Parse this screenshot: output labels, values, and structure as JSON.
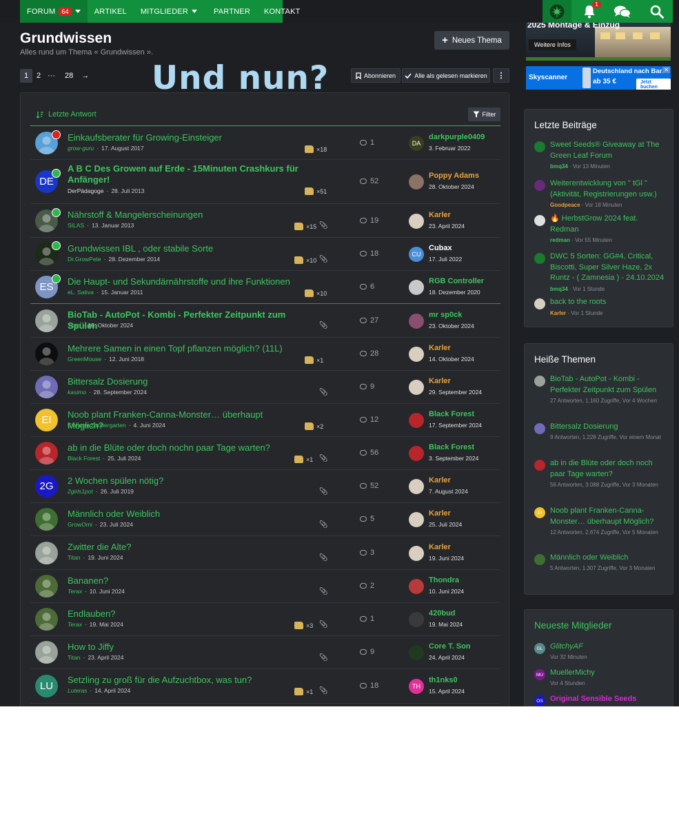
{
  "nav": {
    "items": [
      {
        "label": "FORUM",
        "count": "64",
        "caret": true
      },
      {
        "label": "ARTIKEL"
      },
      {
        "label": "MITGLIEDER",
        "caret": true
      },
      {
        "label": "PARTNER"
      },
      {
        "label": "KONTAKT"
      }
    ],
    "bell_count": "1",
    "icons": [
      "cannabis-leaf-icon",
      "bell-icon",
      "chat-bubbles-icon",
      "search-icon"
    ]
  },
  "page": {
    "title": "Grundwissen",
    "description": "Alles rund um Thema « Grundwissen ».",
    "new_thread": "Neues Thema",
    "overlay_text": "Und nun?"
  },
  "pager": {
    "pages": [
      "1",
      "2",
      "···",
      "28"
    ],
    "current": "1",
    "next": "→"
  },
  "actions": {
    "subscribe": "Abonnieren",
    "mark_read": "Alle als gelesen markieren",
    "more": "⋮"
  },
  "filterbar": {
    "sort": "Letzte Antwort",
    "filter": "Filter"
  },
  "ads": {
    "ad1": {
      "title": "2025 Montage & Einzug",
      "button": "Weitere Infos"
    },
    "ad2": {
      "brand": "Skyscanner",
      "deal": "Deutschland nach Bar...",
      "price": "ab 35 €",
      "cta": "Jetzt buchen",
      "close": "✕"
    }
  },
  "threads": [
    {
      "title": "Einkaufsberater für Growing-Einsteiger",
      "author": "grow-guru",
      "author_italic": true,
      "date": "17. August 2017",
      "likes": "×18",
      "attach": false,
      "replies": "1",
      "last_user": "darkpurple0409",
      "last_date": "3. Februar 2022",
      "last_color": "#3ec55e",
      "last_initials": "DA",
      "last_bg": "#3b3d1f",
      "avatar_initials": "",
      "avatar_bg": "#5aa0d8",
      "badge": "red",
      "bold": false
    },
    {
      "title": "A B C Des Growen auf Erde - 15Minuten Crashkurs für Anfänger!",
      "author": "DerPädagoge",
      "author_italic": false,
      "author_color": "#e0e0e0",
      "date": "28. Juli 2013",
      "likes": "×51",
      "attach": false,
      "replies": "52",
      "last_user": "Poppy Adams",
      "last_date": "28. Oktober 2024",
      "last_color": "#e8a33c",
      "last_initials": "",
      "last_bg": "#8a7264",
      "avatar_initials": "DE",
      "avatar_bg": "#1a36c9",
      "badge": "green",
      "bold": true
    },
    {
      "title": "Nährstoff & Mangelerscheinungen",
      "author": "SILAS",
      "author_italic": false,
      "date": "13. Januar 2013",
      "likes": "×15",
      "attach": true,
      "replies": "19",
      "last_user": "Karler",
      "last_date": "23. April 2024",
      "last_color": "#e8a33c",
      "last_initials": "",
      "last_bg": "#d8cfc0",
      "avatar_initials": "",
      "avatar_bg": "#4a5a48",
      "badge": "green",
      "bold": false
    },
    {
      "title": "Grundwissen IBL , oder stabile Sorte",
      "author": "Dr.GrowPete",
      "author_italic": false,
      "date": "28. Dezember 2014",
      "likes": "×10",
      "attach": true,
      "replies": "18",
      "last_user": "Cubax",
      "last_date": "17. Juli 2022",
      "last_color": "#ffffff",
      "last_initials": "CU",
      "last_bg": "#4a8fd6",
      "avatar_initials": "",
      "avatar_bg": "#1c2a16",
      "badge": "green",
      "bold": false
    },
    {
      "title": "Die Haupt- und Sekundärnährstoffe und ihre Funktionen",
      "author": "eL. Sativa",
      "author_italic": false,
      "date": "15. Januar 2011",
      "likes": "×10",
      "attach": false,
      "replies": "6",
      "last_user": "RGB Controller",
      "last_date": "18. Dezember 2020",
      "last_color": "#3ec55e",
      "last_initials": "",
      "last_bg": "#c9c9c9",
      "avatar_initials": "ES",
      "avatar_bg": "#7d94c4",
      "badge": "green",
      "bold": false
    },
    {
      "title": "BioTab - AutoPot - Kombi - Perfekter Zeitpunkt zum Spülen",
      "author": "Titan",
      "author_italic": false,
      "date": "15. Oktober 2024",
      "likes": "",
      "attach": true,
      "replies": "27",
      "last_user": "mr sp0ck",
      "last_date": "23. Oktober 2024",
      "last_color": "#3ec55e",
      "last_initials": "",
      "last_bg": "#8a4e6e",
      "avatar_initials": "",
      "avatar_bg": "#9aa39a",
      "badge": "",
      "bold": true
    },
    {
      "title": "Mehrere Samen in einen Topf pflanzen möglich? (11L)",
      "author": "GreenMouse",
      "author_italic": false,
      "date": "12. Juni 2018",
      "likes": "×1",
      "attach": false,
      "replies": "28",
      "last_user": "Karler",
      "last_date": "14. Oktober 2024",
      "last_color": "#e8a33c",
      "last_initials": "",
      "last_bg": "#d8cfc0",
      "avatar_initials": "",
      "avatar_bg": "#0d0d0d",
      "badge": "",
      "bold": false
    },
    {
      "title": "Bittersalz Dosierung",
      "author": "kasimo",
      "author_italic": true,
      "date": "28. September 2024",
      "likes": "",
      "attach": true,
      "replies": "9",
      "last_user": "Karler",
      "last_date": "29. September 2024",
      "last_color": "#e8a33c",
      "last_initials": "",
      "last_bg": "#d8cfc0",
      "avatar_initials": "",
      "avatar_bg": "#6f6bb5",
      "badge": "",
      "bold": false
    },
    {
      "title": "Noob plant Franken-Canna-Monster… überhaupt Möglich?",
      "author": "EinhornsZaubergarten",
      "author_italic": false,
      "date": "4. Juni 2024",
      "likes": "×2",
      "attach": false,
      "replies": "12",
      "last_user": "Black Forest",
      "last_date": "17. September 2024",
      "last_color": "#3ec55e",
      "last_initials": "",
      "last_bg": "#b8252a",
      "avatar_initials": "EI",
      "avatar_bg": "#f2c12e",
      "badge": "",
      "bold": false
    },
    {
      "title": "ab in die Blüte oder doch nochn paar Tage warten?",
      "author": "Black Forest",
      "author_italic": false,
      "date": "25. Juli 2024",
      "likes": "×1",
      "attach": true,
      "replies": "56",
      "last_user": "Black Forest",
      "last_date": "3. September 2024",
      "last_color": "#3ec55e",
      "last_initials": "",
      "last_bg": "#b8252a",
      "avatar_initials": "",
      "avatar_bg": "#b8252a",
      "badge": "",
      "bold": false
    },
    {
      "title": "2 Wochen spülen nötig?",
      "author": "2girls1pot",
      "author_italic": true,
      "date": "26. Juli 2019",
      "likes": "",
      "attach": true,
      "replies": "52",
      "last_user": "Karler",
      "last_date": "7. August 2024",
      "last_color": "#e8a33c",
      "last_initials": "",
      "last_bg": "#d8cfc0",
      "avatar_initials": "2G",
      "avatar_bg": "#1a18c4",
      "badge": "",
      "bold": false
    },
    {
      "title": "Männlich oder Weiblich",
      "author": "GrowOmi",
      "author_italic": false,
      "date": "23. Juli 2024",
      "likes": "",
      "attach": true,
      "replies": "5",
      "last_user": "Karler",
      "last_date": "25. Juli 2024",
      "last_color": "#e8a33c",
      "last_initials": "",
      "last_bg": "#d8cfc0",
      "avatar_initials": "",
      "avatar_bg": "#3f6e32",
      "badge": "",
      "bold": false
    },
    {
      "title": "Zwitter die Alte?",
      "author": "Titan",
      "author_italic": false,
      "date": "19. Juni 2024",
      "likes": "",
      "attach": true,
      "replies": "3",
      "last_user": "Karler",
      "last_date": "19. Juni 2024",
      "last_color": "#e8a33c",
      "last_initials": "",
      "last_bg": "#d8cfc0",
      "avatar_initials": "",
      "avatar_bg": "#9aa39a",
      "badge": "",
      "bold": false
    },
    {
      "title": "Bananen?",
      "author": "Terax",
      "author_italic": true,
      "date": "10. Juni 2024",
      "likes": "",
      "attach": true,
      "replies": "2",
      "last_user": "Thondra",
      "last_date": "10. Juni 2024",
      "last_color": "#3ec55e",
      "last_initials": "",
      "last_bg": "#b83a3a",
      "avatar_initials": "",
      "avatar_bg": "#4c6b36",
      "badge": "",
      "bold": false
    },
    {
      "title": "Endlauben?",
      "author": "Terax",
      "author_italic": true,
      "date": "19. Mai 2024",
      "likes": "×3",
      "attach": true,
      "replies": "1",
      "last_user": "420bud",
      "last_date": "19. Mai 2024",
      "last_color": "#3ec55e",
      "last_initials": "",
      "last_bg": "#3a3a3a",
      "avatar_initials": "",
      "avatar_bg": "#4c6b36",
      "badge": "",
      "bold": false
    },
    {
      "title": "How to Jiffy",
      "author": "Titan",
      "author_italic": false,
      "date": "23. April 2024",
      "likes": "",
      "attach": true,
      "replies": "9",
      "last_user": "Core T. Son",
      "last_date": "24. April 2024",
      "last_color": "#3ec55e",
      "last_initials": "",
      "last_bg": "#1f3a1f",
      "avatar_initials": "",
      "avatar_bg": "#9aa39a",
      "badge": "",
      "bold": false
    },
    {
      "title": "Setzling zu groß für die Aufzuchtbox, was tun?",
      "author": "Luteras",
      "author_italic": true,
      "date": "14. April 2024",
      "likes": "×1",
      "attach": true,
      "replies": "18",
      "last_user": "th1nks0",
      "last_date": "15. April 2024",
      "last_color": "#3ec55e",
      "last_initials": "TH",
      "last_bg": "#e0309a",
      "avatar_initials": "LU",
      "avatar_bg": "#2a8a70",
      "badge": "",
      "bold": false
    }
  ],
  "sidebar": {
    "latest": {
      "title": "Letzte Beiträge",
      "items": [
        {
          "title": "Sweet Seeds® Giveaway at The Green Leaf Forum",
          "user": "bmq34",
          "user_orange": false,
          "time": "Vor 13 Minuten",
          "avatar_bg": "#1a7a2e",
          "initials": ""
        },
        {
          "title": "Weiterentwicklung von \" tGl \" (Aktivität, Registrierungen usw.)",
          "user": "Goodpeace",
          "user_orange": true,
          "time": "Vor 18 Minuten",
          "avatar_bg": "#6a2a7a",
          "initials": ""
        },
        {
          "title": "🔥 HerbstGrow 2024 feat. Redman",
          "user": "redman",
          "user_orange": false,
          "time": "Vor 55 Minuten",
          "avatar_bg": "#e0e0e0",
          "initials": ""
        },
        {
          "title": "DWC 5 Sorten: GG#4, Critical, Biscotti, Super Silver Haze, 2x Runtz - ( Zamnesia ) - 24.10.2024",
          "user": "bmq34",
          "user_orange": false,
          "time": "Vor 1 Stunde",
          "avatar_bg": "#1a7a2e",
          "initials": ""
        },
        {
          "title": "back to the roots",
          "user": "Karler",
          "user_orange": true,
          "time": "Vor 1 Stunde",
          "avatar_bg": "#d8cfc0",
          "initials": ""
        }
      ]
    },
    "hot": {
      "title": "Heiße Themen",
      "items": [
        {
          "title": "BioTab - AutoPot - Kombi - Perfekter Zeitpunkt zum Spülen",
          "meta": "27 Antworten, 1.160 Zugriffe, Vor 4 Wochen",
          "avatar_bg": "#9aa39a",
          "initials": ""
        },
        {
          "title": "Bittersalz Dosierung",
          "meta": "9 Antworten, 1.228 Zugriffe, Vor einem Monat",
          "avatar_bg": "#6f6bb5",
          "initials": ""
        },
        {
          "title": "ab in die Blüte oder doch noch paar Tage warten?",
          "meta": "56 Antworten, 3.088 Zugriffe, Vor 3 Monaten",
          "avatar_bg": "#b8252a",
          "initials": ""
        },
        {
          "title": "Noob plant Franken-Canna-Monster… überhaupt Möglich?",
          "meta": "12 Antworten, 2.674 Zugriffe, Vor 5 Monaten",
          "avatar_bg": "#f2c12e",
          "initials": "EI"
        },
        {
          "title": "Männlich oder Weiblich",
          "meta": "5 Antworten, 1.307 Zugriffe, Vor 3 Monaten",
          "avatar_bg": "#3f6e32",
          "initials": ""
        }
      ]
    },
    "members": {
      "title": "Neueste Mitglieder",
      "items": [
        {
          "name": "GlitchyAF",
          "time": "Vor 32 Minuten",
          "initials": "GL",
          "avatar_bg": "#5a8a8a",
          "color": "#3ec55e",
          "italic": true
        },
        {
          "name": "MuellerMichy",
          "time": "Vor 4 Stunden",
          "initials": "MU",
          "avatar_bg": "#7a1a8a",
          "color": "#3ec55e",
          "italic": false
        },
        {
          "name": "Original Sensible Seeds",
          "time": "",
          "initials": "OS",
          "avatar_bg": "#1a18c4",
          "color": "#d22bd0",
          "italic": false
        }
      ]
    }
  }
}
